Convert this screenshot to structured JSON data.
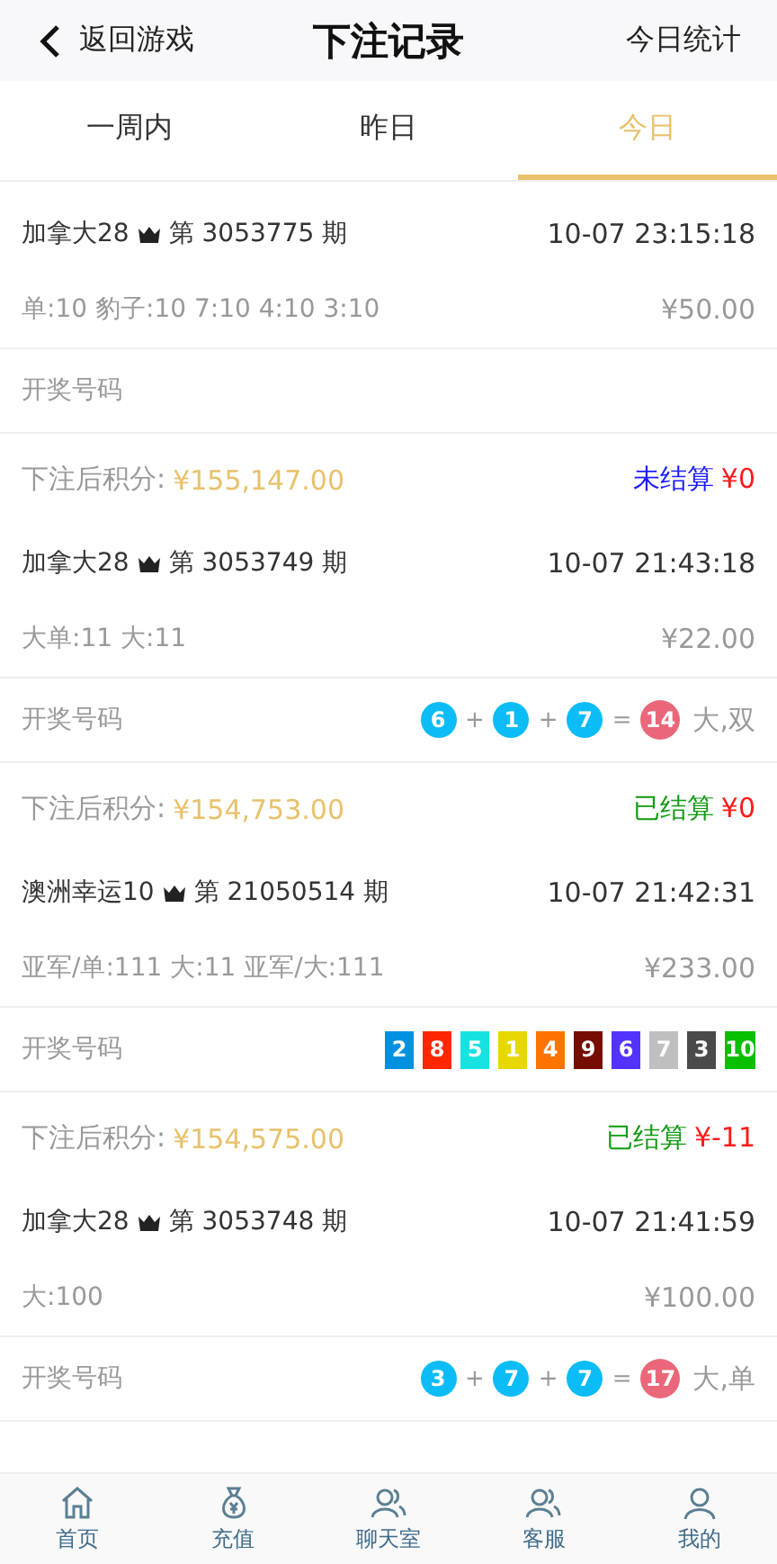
{
  "header": {
    "back_label": "返回游戏",
    "title": "下注记录",
    "action": "今日统计"
  },
  "tabs": [
    {
      "label": "一周内",
      "selected": false
    },
    {
      "label": "昨日",
      "selected": false
    },
    {
      "label": "今日",
      "selected": true
    }
  ],
  "records": [
    {
      "game": "加拿大28",
      "issue": "第 3053775 期",
      "time": "10-07 23:15:18",
      "bet": "单:10 豹子:10 7:10 4:10 3:10",
      "amount": "¥50.00",
      "draw_label": "开奖号码",
      "draw": {
        "kind": "none"
      },
      "balance_label": "下注后积分:",
      "balance": "¥155,147.00",
      "status": "未结算",
      "settled": false,
      "payout": "¥0"
    },
    {
      "game": "加拿大28",
      "issue": "第 3053749 期",
      "time": "10-07 21:43:18",
      "bet": "大单:11 大:11",
      "amount": "¥22.00",
      "draw_label": "开奖号码",
      "draw": {
        "kind": "sum",
        "numbers": [
          "6",
          "1",
          "7"
        ],
        "plus": "+",
        "equals": "=",
        "total": "14",
        "result": "大,双"
      },
      "balance_label": "下注后积分:",
      "balance": "¥154,753.00",
      "status": "已结算",
      "settled": true,
      "payout": "¥0"
    },
    {
      "game": "澳洲幸运10",
      "issue": "第 21050514 期",
      "time": "10-07 21:42:31",
      "bet": "亚军/单:111 大:11 亚军/大:111",
      "amount": "¥233.00",
      "draw_label": "开奖号码",
      "draw": {
        "kind": "ranking",
        "numbers": [
          {
            "text": "2",
            "color": "#0091e0"
          },
          {
            "text": "8",
            "color": "#ff2600"
          },
          {
            "text": "5",
            "color": "#17e2e2"
          },
          {
            "text": "1",
            "color": "#e6d800"
          },
          {
            "text": "4",
            "color": "#ff7300"
          },
          {
            "text": "9",
            "color": "#750e00"
          },
          {
            "text": "6",
            "color": "#5233ff"
          },
          {
            "text": "7",
            "color": "#bfbfbf"
          },
          {
            "text": "3",
            "color": "#4a4a4a"
          },
          {
            "text": "10",
            "color": "#08bf00"
          }
        ]
      },
      "balance_label": "下注后积分:",
      "balance": "¥154,575.00",
      "status": "已结算",
      "settled": true,
      "payout": "¥-11"
    },
    {
      "game": "加拿大28",
      "issue": "第 3053748 期",
      "time": "10-07 21:41:59",
      "bet": "大:100",
      "amount": "¥100.00",
      "draw_label": "开奖号码",
      "draw": {
        "kind": "sum",
        "numbers": [
          "3",
          "7",
          "7"
        ],
        "plus": "+",
        "equals": "=",
        "total": "17",
        "result": "大,单"
      }
    }
  ],
  "nav": [
    {
      "label": "首页",
      "kind": "home"
    },
    {
      "label": "充值",
      "kind": "bag"
    },
    {
      "label": "聊天室",
      "kind": "people"
    },
    {
      "label": "客服",
      "kind": "people"
    },
    {
      "label": "我的",
      "kind": "person"
    }
  ]
}
